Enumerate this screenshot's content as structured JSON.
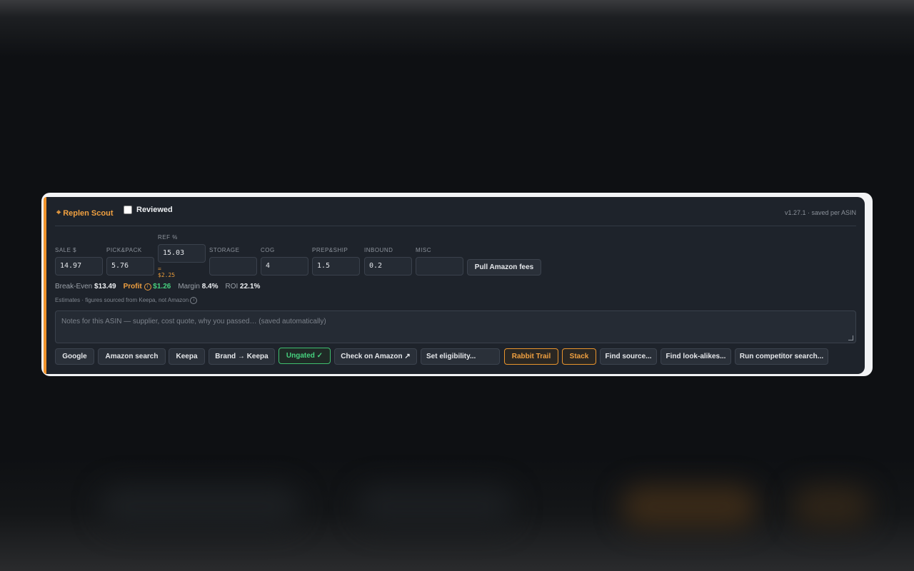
{
  "header": {
    "title": "Replen Scout",
    "title_icon": "crosshair-icon",
    "reviewed_label": "Reviewed",
    "reviewed_checked": false,
    "version": "v1.27.1 · saved per ASIN"
  },
  "fields": {
    "sale": {
      "label": "SALE $",
      "value": "14.97"
    },
    "pickpack": {
      "label": "PICK&PACK",
      "value": "5.76"
    },
    "ref": {
      "label": "REF %",
      "value": "15.03",
      "note": "= $2.25"
    },
    "storage": {
      "label": "STORAGE",
      "value": ""
    },
    "cog": {
      "label": "COG",
      "value": "4"
    },
    "prepship": {
      "label": "PREP&SHIP",
      "value": "1.5"
    },
    "inbound": {
      "label": "INBOUND",
      "value": "0.2"
    },
    "misc": {
      "label": "MISC",
      "value": ""
    }
  },
  "pull_fees_label": "Pull Amazon fees",
  "metrics": {
    "break_even_label": "Break-Even",
    "break_even_value": "$13.49",
    "profit_label": "Profit",
    "profit_value": "$1.26",
    "margin_label": "Margin",
    "margin_value": "8.4%",
    "roi_label": "ROI",
    "roi_value": "22.1%"
  },
  "estimates_text": "Estimates · figures sourced from Keepa, not Amazon",
  "notes_placeholder": "Notes for this ASIN — supplier, cost quote, why you passed… (saved automatically)",
  "actions": {
    "google": "Google",
    "amazon_search": "Amazon search",
    "keepa": "Keepa",
    "brand_keepa": "Brand → Keepa",
    "ungated": "Ungated ✓",
    "check_amazon": "Check on Amazon ↗",
    "set_eligibility": "Set eligibility...",
    "rabbit_trail": "Rabbit Trail",
    "stack": "Stack",
    "find_source": "Find source...",
    "find_lookalikes": "Find look-alikes...",
    "run_competitor": "Run competitor search..."
  },
  "colors": {
    "accent": "#f0932b",
    "success": "#46d17e",
    "panel": "#1e232b"
  }
}
